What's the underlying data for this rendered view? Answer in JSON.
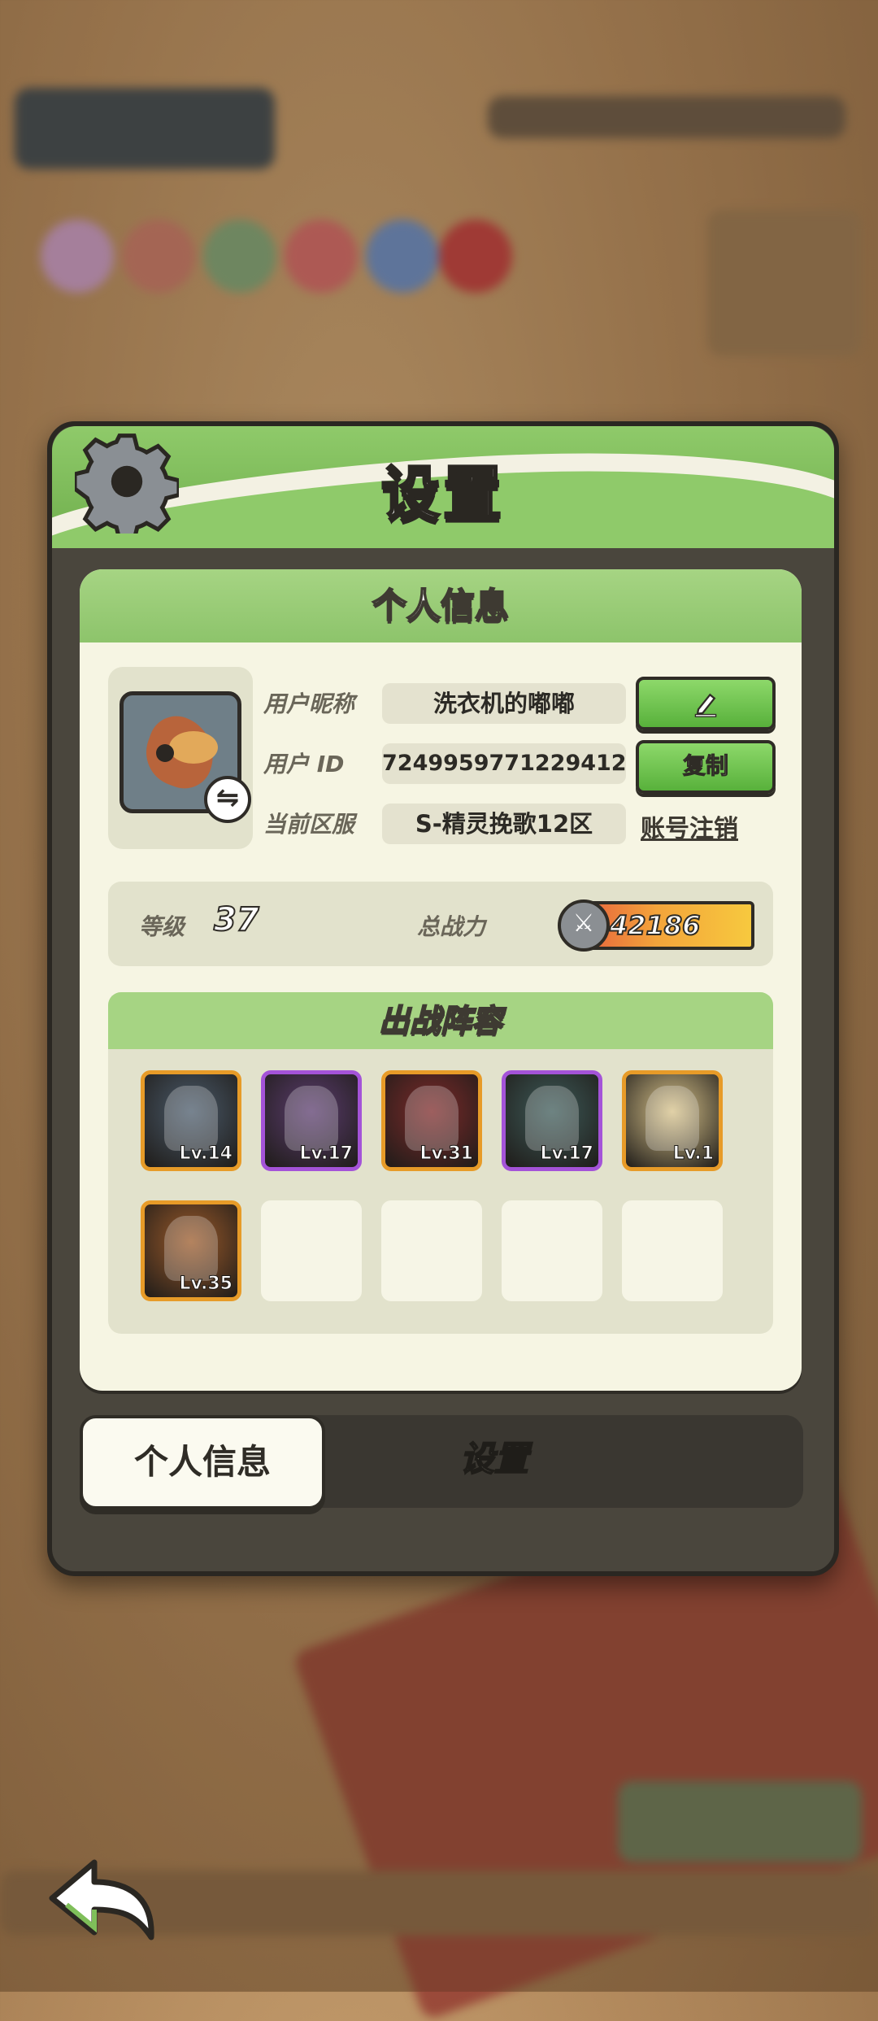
{
  "modal": {
    "title": "设置",
    "panel_header": "个人信息",
    "profile": {
      "nickname_label": "用户昵称",
      "nickname_value": "洗衣机的嘟嘟",
      "id_label": "用户  ID",
      "id_value": "7249959771229412",
      "server_label": "当前区服",
      "server_value": "S-精灵挽歌12区",
      "copy_button": "复制",
      "logout_link": "账号注销"
    },
    "stats": {
      "level_label": "等级",
      "level_value": "37",
      "power_label": "总战力",
      "power_value": "42186"
    },
    "lineup": {
      "header": "出战阵容",
      "heroes": [
        {
          "level": "Lv.14",
          "frame": "orange",
          "color": "#4a5a6a"
        },
        {
          "level": "Lv.17",
          "frame": "purple",
          "color": "#5b3c6e"
        },
        {
          "level": "Lv.31",
          "frame": "orange",
          "color": "#7d2a2a"
        },
        {
          "level": "Lv.17",
          "frame": "purple",
          "color": "#3d5a58"
        },
        {
          "level": "Lv.1",
          "frame": "orange",
          "color": "#d7c28a"
        },
        {
          "level": "Lv.35",
          "frame": "orange",
          "color": "#9b5a2a"
        }
      ],
      "empty_slots": 4
    },
    "tabs": {
      "profile": "个人信息",
      "settings": "设置"
    }
  },
  "colors": {
    "accent_green": "#8dc46b",
    "panel_bg": "#f6f5e3",
    "frame_orange": "#e79b28",
    "frame_purple": "#a453d8"
  }
}
